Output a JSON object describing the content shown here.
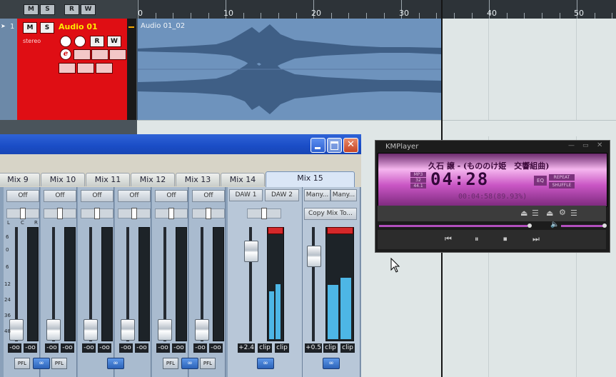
{
  "daw": {
    "header_buttons": [
      "M",
      "S",
      "R",
      "W"
    ],
    "ruler_labels": [
      "0",
      "10",
      "20",
      "30",
      "40",
      "50"
    ],
    "track": {
      "number": "1",
      "mute": "M",
      "solo": "S",
      "name": "Audio 01",
      "channel": "stereo",
      "read": "R",
      "write": "W",
      "edit": "e"
    },
    "clip_name": "Audio 01_02"
  },
  "mixer": {
    "tabs": [
      "Mix 9",
      "Mix 10",
      "Mix 11",
      "Mix 12",
      "Mix 13",
      "Mix 14",
      "Mix 15"
    ],
    "active_tab": "Mix 15",
    "off_label": "Off",
    "daw_tabs": [
      "DAW 1",
      "DAW 2"
    ],
    "many_tabs": [
      "Many...",
      "Many..."
    ],
    "copy_mix": "Copy Mix To...",
    "pan_labels": [
      "L",
      "C",
      "R"
    ],
    "scale": [
      "6",
      "0",
      "6",
      "12",
      "24",
      "36",
      "48"
    ],
    "channel_values": [
      "-oo",
      "-oo"
    ],
    "daw_values": [
      "+2.4",
      "clip",
      "clip"
    ],
    "many_values": [
      "+0.5",
      "clip",
      "clip"
    ],
    "pfl": "PFL"
  },
  "kmplayer": {
    "title": "KMPlayer",
    "song": "久石 譲 - (もののけ姫　交響組曲)",
    "time": "04:28",
    "position": "00:04:58(89.93%)",
    "badges": [
      "MP3",
      "32",
      "44.1"
    ],
    "repeat": "REPEAT",
    "shuffle": "SHUFFLE",
    "eq": "EQ",
    "colors": {
      "display": "#e9a0e3",
      "accent": "#b24fbd"
    }
  }
}
